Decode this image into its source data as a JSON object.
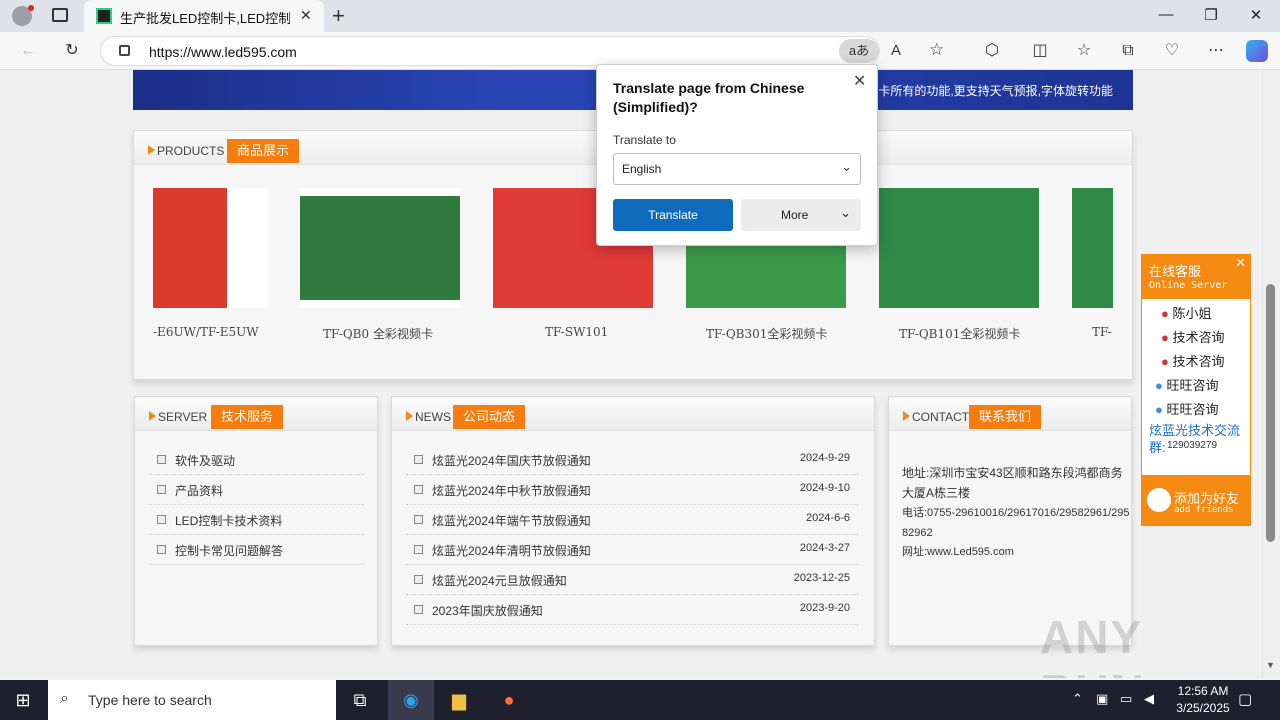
{
  "browser": {
    "tab_title": "生产批发LED控制卡,LED控制卡,G",
    "url": "https://www.led595.com",
    "new_tab_label": "+",
    "window_controls": {
      "minimize": "—",
      "restore": "❐",
      "close": "✕"
    }
  },
  "page": {
    "banner_text": "卡所有的功能,更支持天气预报,字体旋转功能",
    "products": {
      "title": "PRODUCTS",
      "tag": "商品展示",
      "items": [
        {
          "caption": "-E6UW/TF-E5UW"
        },
        {
          "caption": "TF-QB0 全彩视频卡"
        },
        {
          "caption": "TF-SW101"
        },
        {
          "caption": "TF-QB301全彩视频卡"
        },
        {
          "caption": "TF-QB101全彩视频卡"
        },
        {
          "caption": "TF-"
        }
      ]
    },
    "server": {
      "title": "SERVER",
      "tag": "技术服务",
      "items": [
        "软件及驱动",
        "产品资料",
        "LED控制卡技术资料",
        "控制卡常见问题解答"
      ]
    },
    "news": {
      "title": "NEWS",
      "tag": "公司动态",
      "items": [
        {
          "title": "炫蓝光2024年国庆节放假通知",
          "date": "2024-9-29"
        },
        {
          "title": "炫蓝光2024年中秋节放假通知",
          "date": "2024-9-10"
        },
        {
          "title": "炫蓝光2024年端午节放假通知",
          "date": "2024-6-6"
        },
        {
          "title": "炫蓝光2024年清明节放假通知",
          "date": "2024-3-27"
        },
        {
          "title": "炫蓝光2024元旦放假通知",
          "date": "2023-12-25"
        },
        {
          "title": "2023年国庆放假通知",
          "date": "2023-9-20"
        }
      ]
    },
    "contact": {
      "title": "CONTACT",
      "tag": "联系我们",
      "address": "地址:深圳市宝安43区顺和路东段鸿都商务大厦A栋三楼",
      "phone": "电话:0755-29610016/29617016/29582961/29582962",
      "website": "网址:www.Led595.com"
    }
  },
  "translate_popup": {
    "title": "Translate page from Chinese (Simplified)?",
    "translate_to_label": "Translate to",
    "language": "English",
    "translate_button": "Translate",
    "more_button": "More"
  },
  "online_server": {
    "title": "在线客服",
    "subtitle": "Online Server",
    "contacts": [
      "陈小姐",
      "技术咨询",
      "技术咨询",
      "旺旺咨询",
      "旺旺咨询"
    ],
    "group_label": "炫蓝光技术交流群:",
    "group_number": "129039279",
    "add_friends": "添加为好友",
    "add_friends_en": "add friends"
  },
  "taskbar": {
    "search_placeholder": "Type here to search",
    "time": "12:56 AM",
    "date": "3/25/2025"
  },
  "watermark": "ANY RUN"
}
